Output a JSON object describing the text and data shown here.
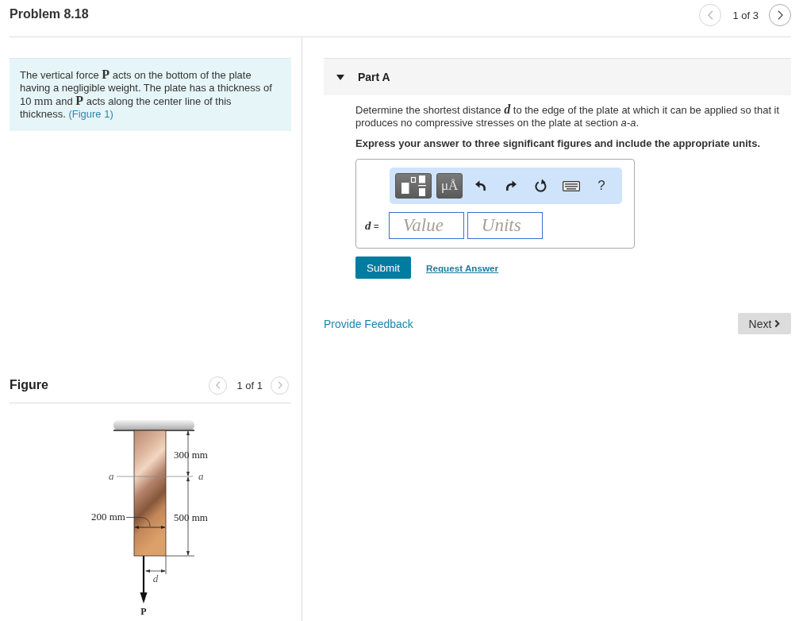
{
  "header": {
    "title": "Problem 8.18",
    "pager": {
      "prev_button": {
        "disabled": true
      },
      "position": "1 of 3",
      "next_button": {
        "disabled": false
      }
    }
  },
  "problem": {
    "statement": [
      {
        "kind": "text",
        "text": "The vertical force "
      },
      {
        "kind": "symbol",
        "text": "P"
      },
      {
        "kind": "text",
        "text": " acts on the bottom of the plate having a negligible weight. The plate has a thickness of 10 "
      },
      {
        "kind": "unit",
        "text": "mm"
      },
      {
        "kind": "text",
        "text": " and "
      },
      {
        "kind": "symbol",
        "text": "P"
      },
      {
        "kind": "text",
        "text": " acts along the center line of this thickness. "
      },
      {
        "kind": "link",
        "text": "(Figure 1)"
      }
    ]
  },
  "figure": {
    "title": "Figure",
    "pager": {
      "prev_button": {
        "disabled": true
      },
      "position": "1 of 1",
      "next_button": {
        "disabled": true
      }
    },
    "labels": {
      "top_dimension": "300 mm",
      "section_left": "a",
      "section_right": "a",
      "width_dimension": "200 mm",
      "bottom_dimension": "500 mm",
      "offset": "d",
      "force": "P"
    }
  },
  "part": {
    "title": "Part A",
    "expanded": true,
    "question": [
      {
        "kind": "text",
        "text": "Determine the shortest distance "
      },
      {
        "kind": "variable",
        "text": "d"
      },
      {
        "kind": "text",
        "text": " to the edge of the plate at which it can be applied so that it produces no compressive stresses on the plate at section "
      },
      {
        "kind": "italic",
        "text": "a-a"
      },
      {
        "kind": "text",
        "text": "."
      }
    ],
    "instruction": "Express your answer to three significant figures and include the appropriate units.",
    "answer": {
      "toolbar": {
        "units_button": "μÅ",
        "help_button": "?"
      },
      "label": [
        {
          "kind": "variable",
          "text": "d"
        },
        {
          "kind": "text",
          "text": " ="
        }
      ],
      "value": {
        "placeholder": "Value"
      },
      "units": {
        "placeholder": "Units"
      }
    },
    "submit_button": "Submit",
    "request_answer_link": "Request Answer"
  },
  "footer": {
    "feedback_link": "Provide Feedback",
    "next_button": "Next"
  }
}
